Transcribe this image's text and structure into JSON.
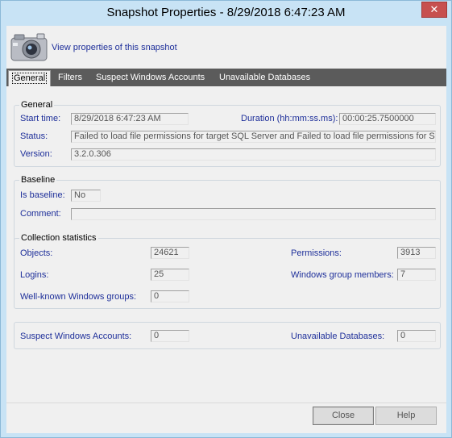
{
  "window": {
    "title": "Snapshot Properties - 8/29/2018 6:47:23 AM",
    "close_glyph": "✕"
  },
  "header": {
    "link": "View properties of this snapshot",
    "icon": "camera-icon"
  },
  "tabs": [
    "General",
    "Filters",
    "Suspect Windows Accounts",
    "Unavailable Databases"
  ],
  "general": {
    "title": "General",
    "start_time_label": "Start time:",
    "start_time": "8/29/2018 6:47:23 AM",
    "duration_label": "Duration (hh:mm:ss.ms):",
    "duration": "00:00:25.7500000",
    "status_label": "Status:",
    "status": "Failed to load file permissions for target SQL Server and Failed to load file permissions for SQ...",
    "version_label": "Version:",
    "version": "3.2.0.306"
  },
  "baseline": {
    "title": "Baseline",
    "is_baseline_label": "Is baseline:",
    "is_baseline": "No",
    "comment_label": "Comment:",
    "comment": ""
  },
  "stats": {
    "title": "Collection statistics",
    "objects_label": "Objects:",
    "objects": "24621",
    "permissions_label": "Permissions:",
    "permissions": "3913",
    "logins_label": "Logins:",
    "logins": "25",
    "wgm_label": "Windows group members:",
    "wgm": "7",
    "wkwg_label": "Well-known Windows groups:",
    "wkwg": "0"
  },
  "suspect": {
    "swa_label": "Suspect Windows Accounts:",
    "swa": "0",
    "udb_label": "Unavailable Databases:",
    "udb": "0"
  },
  "buttons": {
    "close": "Close",
    "help": "Help"
  }
}
